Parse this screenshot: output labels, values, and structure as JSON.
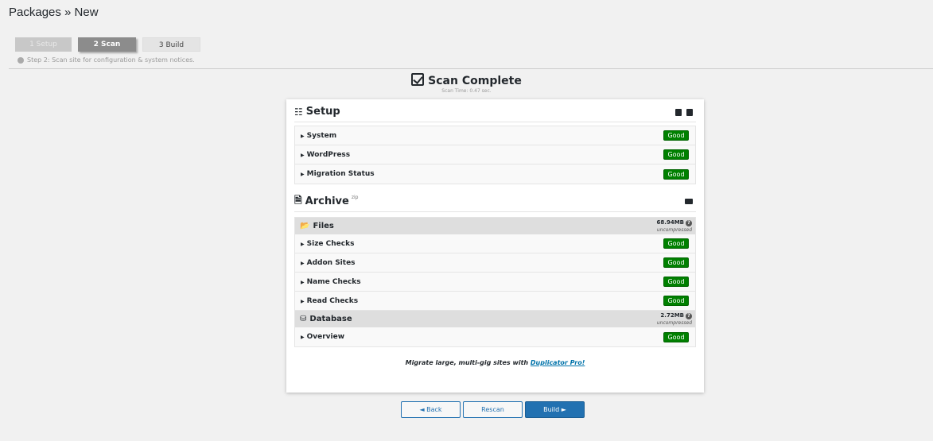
{
  "header": {
    "title": "Packages » New"
  },
  "steps": [
    {
      "label": "1 Setup"
    },
    {
      "label": "2 Scan"
    },
    {
      "label": "3 Build"
    }
  ],
  "step_note": "Step 2: Scan site for configuration & system notices.",
  "scan": {
    "title": "Scan Complete",
    "time": "Scan Time: 0.47 sec."
  },
  "setup": {
    "title": "Setup",
    "items": [
      {
        "label": "System",
        "status": "Good"
      },
      {
        "label": "WordPress",
        "status": "Good"
      },
      {
        "label": "Migration Status",
        "status": "Good"
      }
    ]
  },
  "archive": {
    "title": "Archive",
    "tag": "zip",
    "files": {
      "title": "Files",
      "size": "68.94MB",
      "size_note": "uncompressed",
      "items": [
        {
          "label": "Size Checks",
          "status": "Good"
        },
        {
          "label": "Addon Sites",
          "status": "Good"
        },
        {
          "label": "Name Checks",
          "status": "Good"
        },
        {
          "label": "Read Checks",
          "status": "Good"
        }
      ]
    },
    "database": {
      "title": "Database",
      "size": "2.72MB",
      "size_note": "uncompressed",
      "items": [
        {
          "label": "Overview",
          "status": "Good"
        }
      ]
    }
  },
  "promo": {
    "text": "Migrate large, multi-gig sites with ",
    "link": "Duplicator Pro!"
  },
  "buttons": {
    "back": "◄ Back",
    "rescan": "Rescan",
    "build": "Build ►"
  },
  "colors": {
    "good": "#008000",
    "primary": "#2271b1"
  }
}
